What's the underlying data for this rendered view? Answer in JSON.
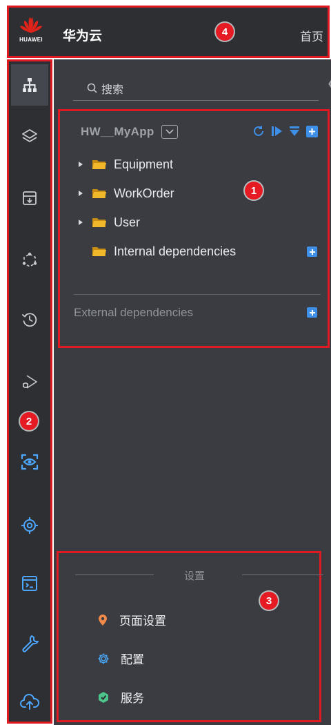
{
  "header": {
    "logo_text": "HUAWEI",
    "brand": "华为云",
    "home_link": "首页"
  },
  "badges": {
    "b1": "1",
    "b2": "2",
    "b3": "3",
    "b4": "4"
  },
  "search": {
    "placeholder": "搜索"
  },
  "project": {
    "app_name": "HW__MyApp",
    "tree": [
      {
        "label": "Equipment",
        "expandable": true
      },
      {
        "label": "WorkOrder",
        "expandable": true
      },
      {
        "label": "User",
        "expandable": true
      },
      {
        "label": "Internal dependencies",
        "expandable": false
      }
    ],
    "external_label": "External dependencies"
  },
  "rail_icons": [
    "sitemap-icon",
    "layers-icon",
    "archive-icon",
    "hexagon-nodes-icon",
    "history-icon",
    "debug-play-icon",
    "eye-scan-icon",
    "target-icon",
    "terminal-icon",
    "wrench-icon",
    "cloud-upload-icon"
  ],
  "settings": {
    "title": "设置",
    "items": [
      {
        "label": "页面设置",
        "icon": "location-pin-icon",
        "color": "#f08a4b"
      },
      {
        "label": "配置",
        "icon": "gear-icon",
        "color": "#4aa3f0"
      },
      {
        "label": "服务",
        "icon": "service-hex-icon",
        "color": "#4cc48a"
      }
    ]
  },
  "colors": {
    "accent": "#3d8fe8",
    "highlight_box": "#e01a22",
    "folder": "#f2b82c"
  }
}
